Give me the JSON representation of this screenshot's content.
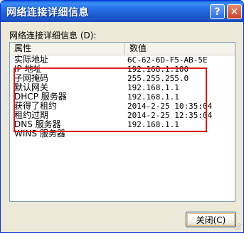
{
  "window": {
    "title": "网络连接详细信息",
    "help_icon": "?",
    "close_icon": "✕"
  },
  "group": {
    "label": "网络连接详细信息 (D):"
  },
  "list": {
    "columns": [
      "属性",
      "数值"
    ],
    "rows": [
      {
        "property": "实际地址",
        "value": "6C-62-6D-F5-AB-5E"
      },
      {
        "property": "IP 地址",
        "value": "192.168.1.100"
      },
      {
        "property": "子网掩码",
        "value": "255.255.255.0"
      },
      {
        "property": "默认网关",
        "value": "192.168.1.1"
      },
      {
        "property": "DHCP 服务器",
        "value": "192.168.1.1"
      },
      {
        "property": "获得了租约",
        "value": "2014-2-25 10:35:04"
      },
      {
        "property": "租约过期",
        "value": "2014-2-25 12:35:04"
      },
      {
        "property": "DNS 服务器",
        "value": "192.168.1.1"
      },
      {
        "property": "WINS 服务器",
        "value": ""
      }
    ],
    "highlight_color": "#e11a1a"
  },
  "footer": {
    "close_button": "关闭(C)"
  },
  "colors": {
    "titlebar": "#1f5fd6",
    "dialog_bg": "#ece9d8",
    "list_border": "#7f9db9"
  }
}
